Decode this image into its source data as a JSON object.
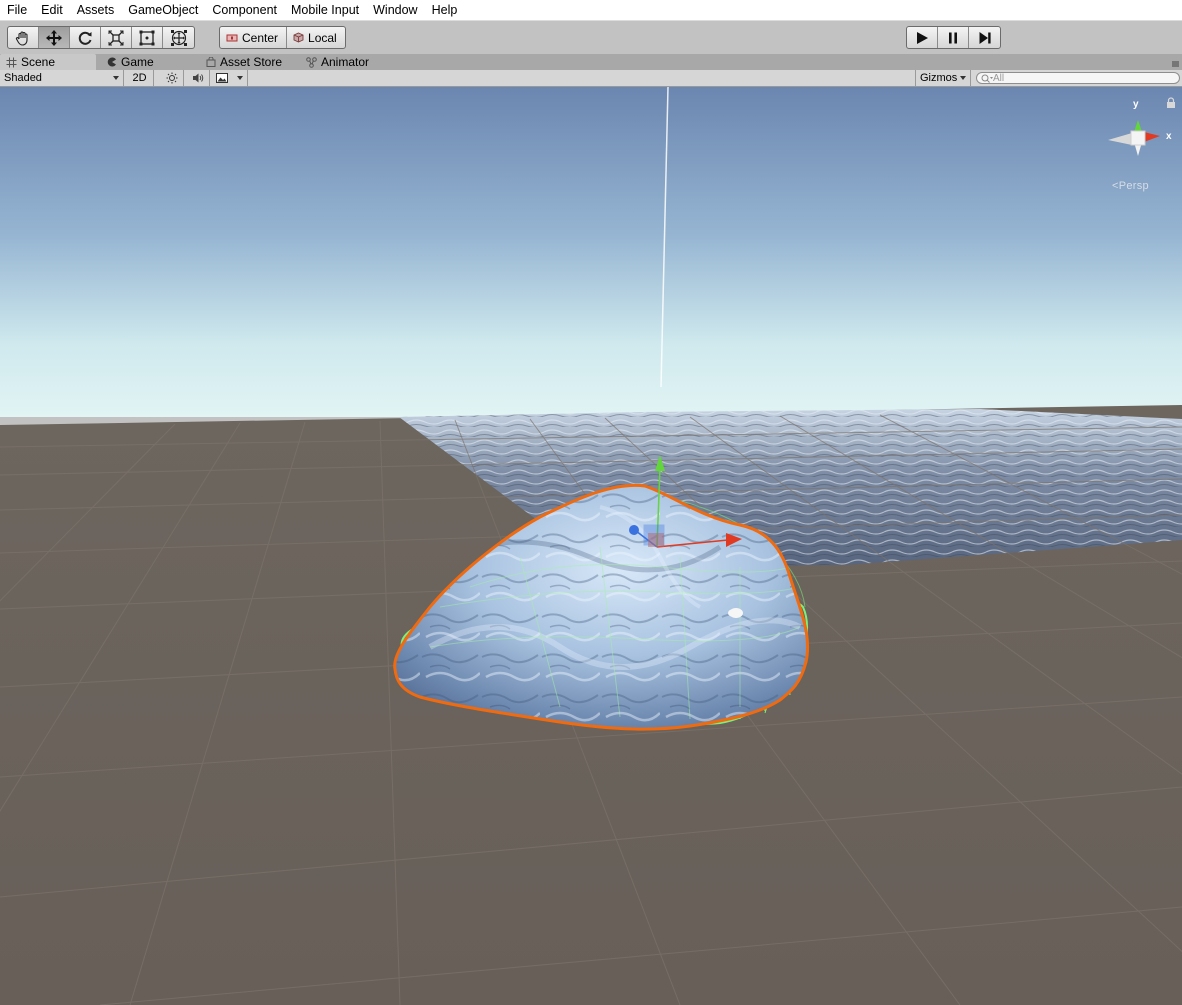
{
  "menu": [
    "File",
    "Edit",
    "Assets",
    "GameObject",
    "Component",
    "Mobile Input",
    "Window",
    "Help"
  ],
  "toolbar": {
    "tools": [
      {
        "name": "hand-tool-icon",
        "active": false
      },
      {
        "name": "move-tool-icon",
        "active": true
      },
      {
        "name": "rotate-tool-icon",
        "active": false
      },
      {
        "name": "scale-tool-icon",
        "active": false
      },
      {
        "name": "rect-tool-icon",
        "active": false
      },
      {
        "name": "transform-tool-icon",
        "active": false
      }
    ],
    "pivot_label": "Center",
    "space_label": "Local",
    "playback": [
      "play-icon",
      "pause-icon",
      "step-icon"
    ]
  },
  "tabs": {
    "scene": "Scene",
    "game": "Game",
    "asset_store": "Asset Store",
    "animator": "Animator"
  },
  "scene_toolbar": {
    "draw_mode": "Shaded",
    "mode_2d": "2D",
    "gizmos": "Gizmos",
    "search_placeholder": "All"
  },
  "gizmo": {
    "y_label": "y",
    "x_label": "x",
    "projection": "Persp"
  },
  "colors": {
    "selection_outline": "#f06a10",
    "collider_wireframe": "#7cf07c",
    "ground": "#6a625c",
    "sky_top": "#6b86b0",
    "sky_horizon": "#dff2f4",
    "axis_y": "#62d63a",
    "axis_x": "#e03a22",
    "axis_z": "#3a72e0"
  }
}
